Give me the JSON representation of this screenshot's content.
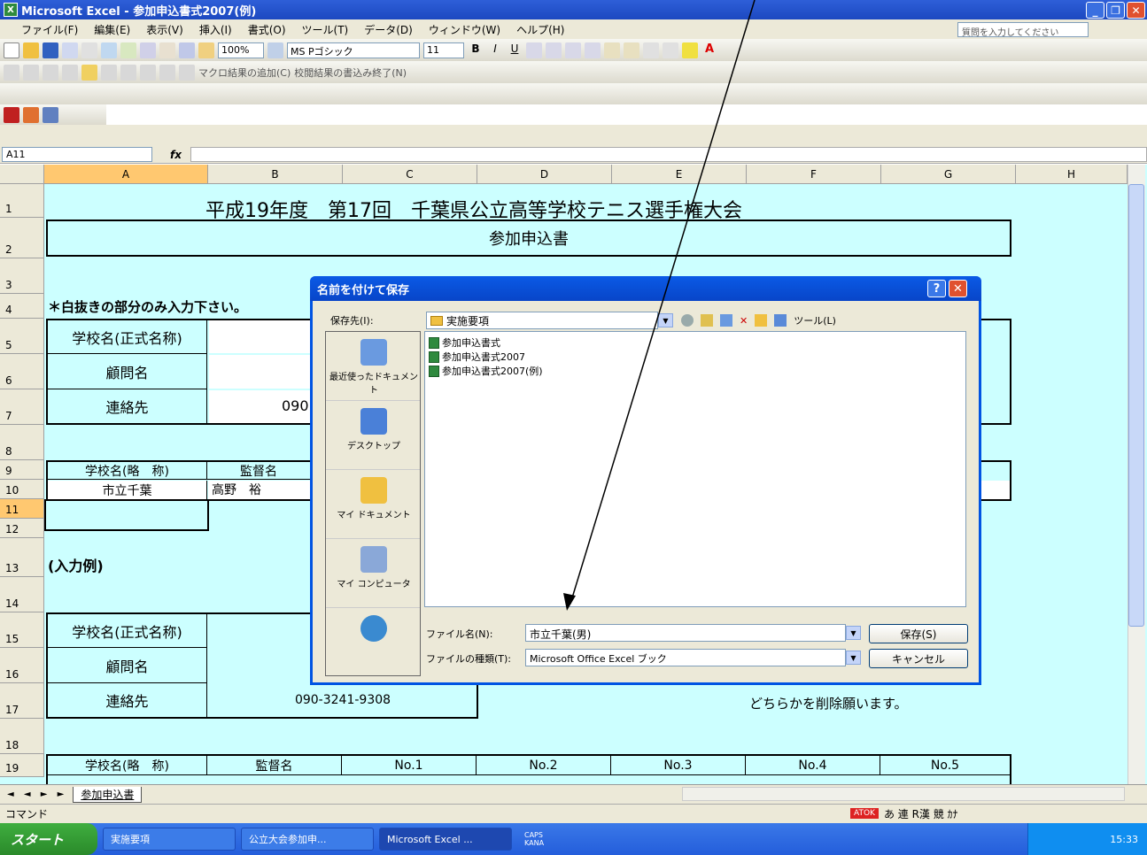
{
  "window": {
    "title": "Microsoft Excel - 参加申込書式2007(例)"
  },
  "menu": [
    "ファイル(F)",
    "編集(E)",
    "表示(V)",
    "挿入(I)",
    "書式(O)",
    "ツール(T)",
    "データ(D)",
    "ウィンドウ(W)",
    "ヘルプ(H)"
  ],
  "help_placeholder": "質問を入力してください",
  "toolbar": {
    "zoom": "100%",
    "font": "MS Pゴシック",
    "size": "11",
    "extra_btn1": "マクロ結果の追加(C)",
    "extra_btn2": "校閲結果の書込み終了(N)"
  },
  "formula": {
    "namebox": "A11",
    "fx": "fx"
  },
  "columns": [
    "A",
    "B",
    "C",
    "D",
    "E",
    "F",
    "G",
    "H"
  ],
  "rows": [
    "1",
    "2",
    "3",
    "4",
    "5",
    "6",
    "7",
    "8",
    "9",
    "10",
    "11",
    "12",
    "13",
    "14",
    "15",
    "16",
    "17",
    "18",
    "19"
  ],
  "sheet": {
    "title": "平成19年度　第17回　千葉県公立高等学校テニス選手権大会",
    "subtitle": "参加申込書",
    "note": "＊白抜きの部分のみ入力下さい。",
    "school_name_label": "学校名(正式名称)",
    "advisor_label": "顧問名",
    "contact_label": "連絡先",
    "contact_value_partial": "090",
    "short_name_label": "学校名(略　称)",
    "coach_label": "監督名",
    "row10_school": "市立千葉",
    "row10_coach": "高野　裕",
    "example_label": "(入力例)",
    "contact_value": "090-3241-9308",
    "delete_note": "どちらかを削除願います。",
    "no1": "No.1",
    "no2": "No.2",
    "no3": "No.3",
    "no4": "No.4",
    "no5": "No.5"
  },
  "tabbar": {
    "nav": "◄ ◄ ► ►",
    "sheet_tab": "参加申込書"
  },
  "status": {
    "mode": "コマンド"
  },
  "ime": {
    "atok": "ATOK",
    "items": "あ 連 R漢 競 ｶﾅ"
  },
  "dialog": {
    "title": "名前を付けて保存",
    "save_in_label": "保存先(I):",
    "save_in_value": "実施要項",
    "tools_label": "ツール(L)",
    "places": [
      "最近使ったドキュメント",
      "デスクトップ",
      "マイ ドキュメント",
      "マイ コンピュータ",
      ""
    ],
    "files": [
      "参加申込書式",
      "参加申込書式2007",
      "参加申込書式2007(例)"
    ],
    "filename_label": "ファイル名(N):",
    "filename_value": "市立千葉(男)",
    "filetype_label": "ファイルの種類(T):",
    "filetype_value": "Microsoft Office Excel ブック",
    "save_button": "保存(S)",
    "cancel_button": "キャンセル"
  },
  "taskbar": {
    "start": "スタート",
    "tasks": [
      "実施要項",
      "公立大会参加申...",
      "Microsoft Excel ..."
    ],
    "caps": "CAPS",
    "kana": "KANA",
    "clock": "15:33"
  },
  "colors": {
    "sheet_bg": "#ccffff",
    "title_blue": "#0a5ae6",
    "selected_header": "#ffc870"
  }
}
